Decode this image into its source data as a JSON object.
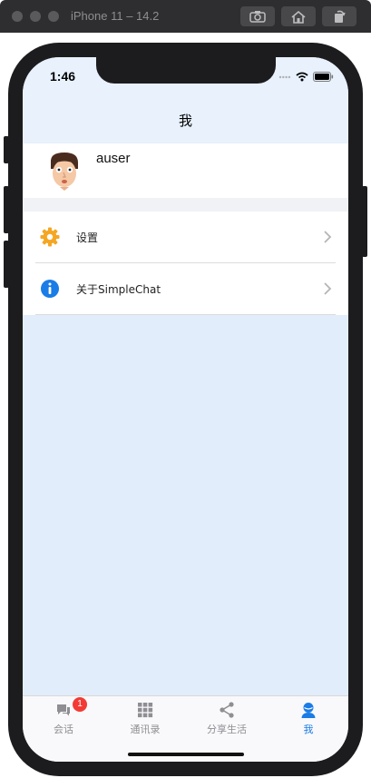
{
  "simulator": {
    "title": "iPhone 11 – 14.2",
    "buttons": [
      "screenshot-icon",
      "home-icon",
      "rotate-icon"
    ]
  },
  "status_bar": {
    "time": "1:46",
    "icons": [
      "signal-icon",
      "wifi-icon",
      "battery-icon"
    ]
  },
  "nav": {
    "title": "我"
  },
  "profile": {
    "username": "auser",
    "avatar": "avatar-icon"
  },
  "menu": {
    "items": [
      {
        "label": "设置",
        "icon": "gear-icon",
        "icon_color": "#f5a623"
      },
      {
        "label": "关于SimpleChat",
        "icon": "info-icon",
        "icon_color": "#1a7ce6"
      }
    ]
  },
  "tabs": {
    "items": [
      {
        "label": "会话",
        "icon": "chat-icon",
        "badge": "1"
      },
      {
        "label": "通讯录",
        "icon": "grid-icon"
      },
      {
        "label": "分享生活",
        "icon": "share-icon"
      },
      {
        "label": "我",
        "icon": "person-icon",
        "active": true
      }
    ]
  },
  "colors": {
    "accent": "#1a7ce6",
    "badge": "#f23b35",
    "background": "#e1edfa"
  }
}
